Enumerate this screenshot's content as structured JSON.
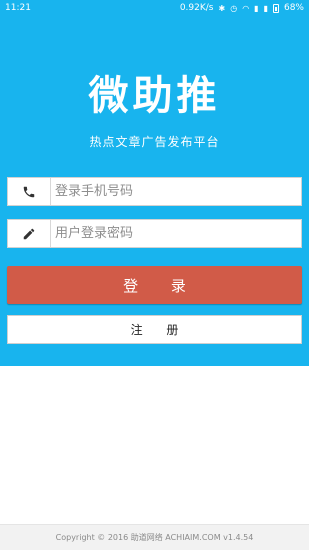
{
  "status_bar": {
    "time": "11:21",
    "network_speed": "0.92K/s",
    "battery": "68%"
  },
  "app": {
    "logo_text": "微助推",
    "slogan": "热点文章广告发布平台"
  },
  "form": {
    "phone_placeholder": "登录手机号码",
    "phone_icon": "phone-icon",
    "password_placeholder": "用户登录密码",
    "password_icon": "pencil-icon",
    "login_label": "登 录",
    "register_label": "注 册"
  },
  "footer": {
    "copyright": "Copyright © 2016 助道网络 ACHIAIM.COM v1.4.54"
  },
  "colors": {
    "hero_bg": "#18b4ee",
    "login_bg": "#d15b48",
    "footer_bg": "#f2f2f2"
  }
}
